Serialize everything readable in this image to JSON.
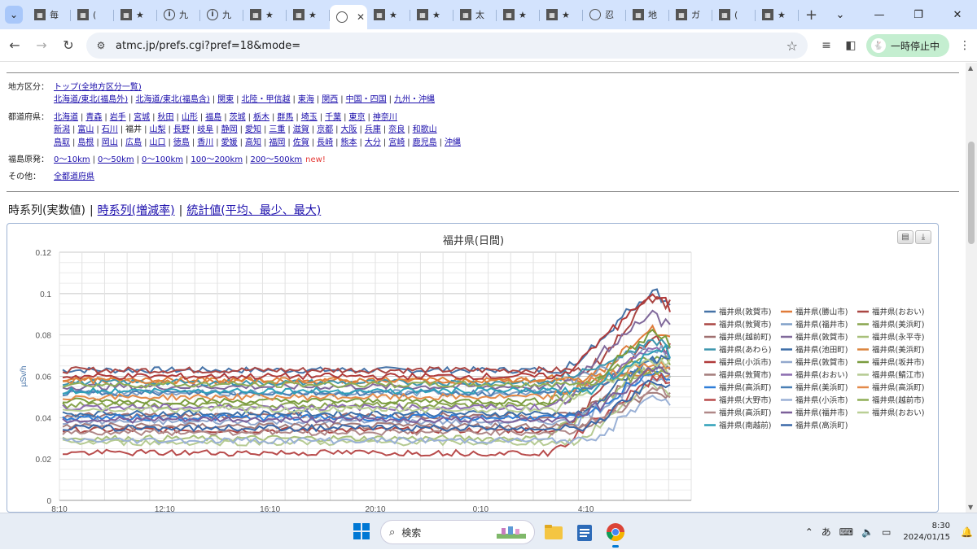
{
  "browser": {
    "tabs": [
      {
        "icon": "doc-icon",
        "label": "毎"
      },
      {
        "icon": "doc-icon",
        "label": "("
      },
      {
        "icon": "doc-icon",
        "label": "★"
      },
      {
        "icon": "info-icon",
        "label": "九"
      },
      {
        "icon": "info-icon",
        "label": "九"
      },
      {
        "icon": "doc-icon",
        "label": "★"
      },
      {
        "icon": "doc-icon",
        "label": "★"
      },
      {
        "icon": "globe-icon",
        "label": "",
        "active": true
      },
      {
        "icon": "doc-icon",
        "label": "★"
      },
      {
        "icon": "doc-icon",
        "label": "★"
      },
      {
        "icon": "doc-icon",
        "label": "太"
      },
      {
        "icon": "doc-icon",
        "label": "★"
      },
      {
        "icon": "doc-icon",
        "label": "★"
      },
      {
        "icon": "globe-icon",
        "label": "忍"
      },
      {
        "icon": "doc-icon",
        "label": "地"
      },
      {
        "icon": "doc-icon",
        "label": "ガ"
      },
      {
        "icon": "doc-icon",
        "label": "("
      },
      {
        "icon": "doc-icon",
        "label": "★"
      }
    ],
    "url": "atmc.jp/prefs.cgi?pref=18&mode=",
    "pause_label": "一時停止中"
  },
  "nav": {
    "region": {
      "label": "地方区分：",
      "lines": [
        [
          "トップ(全地方区分一覧)"
        ],
        [
          "北海道/東北(福島外)",
          "北海道/東北(福島含)",
          "関東",
          "北陸・甲信越",
          "東海",
          "関西",
          "中国・四国",
          "九州・沖縄"
        ]
      ]
    },
    "prefs": {
      "label": "都道府県：",
      "lines": [
        [
          "北海道",
          "青森",
          "岩手",
          "宮城",
          "秋田",
          "山形",
          "福島",
          "茨城",
          "栃木",
          "群馬",
          "埼玉",
          "千葉",
          "東京",
          "神奈川"
        ],
        [
          "新潟",
          "富山",
          "石川",
          "*福井",
          "山梨",
          "長野",
          "岐阜",
          "静岡",
          "愛知",
          "三重",
          "滋賀",
          "京都",
          "大阪",
          "兵庫",
          "奈良",
          "和歌山"
        ],
        [
          "鳥取",
          "島根",
          "岡山",
          "広島",
          "山口",
          "徳島",
          "香川",
          "愛媛",
          "高知",
          "福岡",
          "佐賀",
          "長崎",
          "熊本",
          "大分",
          "宮崎",
          "鹿児島",
          "沖縄"
        ]
      ]
    },
    "fukushima": {
      "label": "福島原発：",
      "links": [
        "0〜10km",
        "0〜50km",
        "0〜100km",
        "100〜200km",
        "200〜500km"
      ],
      "new_label": "new!"
    },
    "other": {
      "label": "その他：",
      "links": [
        "全都道府県"
      ]
    }
  },
  "modes": {
    "current": "時系列(実数値)",
    "links": [
      "時系列(増減率)",
      "統計値(平均、最少、最大)"
    ]
  },
  "chart_data": {
    "type": "line",
    "title": "福井県(日間)",
    "ylabel": "µSv/h",
    "xlabel": "",
    "ylim": [
      0,
      0.12
    ],
    "yticks": [
      "0",
      "0.02",
      "0.04",
      "0.06",
      "0.08",
      "0.1",
      "0.12"
    ],
    "xticks": [
      "8:10",
      "12:10",
      "16:10",
      "20:10",
      "0:10",
      "4:10"
    ],
    "grid": true,
    "legend_position": "right",
    "series": [
      {
        "name": "福井県(敦賀市)",
        "color": "#4572a7",
        "base": 0.063,
        "peak": 0.102
      },
      {
        "name": "福井県(勝山市)",
        "color": "#e07b39",
        "base": 0.058,
        "peak": 0.084
      },
      {
        "name": "福井県(おおい)",
        "color": "#aa4643",
        "base": 0.063,
        "peak": 0.099
      },
      {
        "name": "福井県(敦賀市)",
        "color": "#aa4643",
        "base": 0.034,
        "peak": 0.078
      },
      {
        "name": "福井県(福井市)",
        "color": "#80a0c8",
        "base": 0.052,
        "peak": 0.074
      },
      {
        "name": "福井県(美浜町)",
        "color": "#89a54e",
        "base": 0.046,
        "peak": 0.07
      },
      {
        "name": "福井県(越前町)",
        "color": "#a07070",
        "base": 0.041,
        "peak": 0.066
      },
      {
        "name": "福井県(敦賀市)",
        "color": "#80699b",
        "base": 0.055,
        "peak": 0.091
      },
      {
        "name": "福井県(永平寺)",
        "color": "#a8c07a",
        "base": 0.03,
        "peak": 0.064
      },
      {
        "name": "福井県(あわら)",
        "color": "#3d96ae",
        "base": 0.057,
        "peak": 0.076
      },
      {
        "name": "福井県(池田町)",
        "color": "#3d6ea8",
        "base": 0.042,
        "peak": 0.069
      },
      {
        "name": "福井県(美浜町)",
        "color": "#db843d",
        "base": 0.058,
        "peak": 0.061
      },
      {
        "name": "福井県(小浜市)",
        "color": "#b03a3a",
        "base": 0.06,
        "peak": 0.1
      },
      {
        "name": "福井県(敦賀市)",
        "color": "#92a8cd",
        "base": 0.038,
        "peak": 0.06
      },
      {
        "name": "福井県(坂井市)",
        "color": "#7a9c3e",
        "base": 0.048,
        "peak": 0.081
      },
      {
        "name": "福井県(敦賀市)",
        "color": "#a47d7c",
        "base": 0.036,
        "peak": 0.052
      },
      {
        "name": "福井県(おおい)",
        "color": "#8c6db0",
        "base": 0.045,
        "peak": 0.073
      },
      {
        "name": "福井県(鯖江市)",
        "color": "#b5ca92",
        "base": 0.028,
        "peak": 0.058
      },
      {
        "name": "福井県(高浜町)",
        "color": "#2f7ed8",
        "base": 0.04,
        "peak": 0.062
      },
      {
        "name": "福井県(美浜町)",
        "color": "#4a7fb5",
        "base": 0.052,
        "peak": 0.066
      },
      {
        "name": "福井県(高浜町)",
        "color": "#e38a4a",
        "base": 0.05,
        "peak": 0.067
      },
      {
        "name": "福井県(大野市)",
        "color": "#b84b4b",
        "base": 0.023,
        "peak": 0.059
      },
      {
        "name": "福井県(小浜市)",
        "color": "#9ab1d6",
        "base": 0.029,
        "peak": 0.05
      },
      {
        "name": "福井県(越前市)",
        "color": "#8fad55",
        "base": 0.056,
        "peak": 0.062
      },
      {
        "name": "福井県(高浜町)",
        "color": "#b08888",
        "base": 0.033,
        "peak": 0.054
      },
      {
        "name": "福井県(福井市)",
        "color": "#7c5f99",
        "base": 0.039,
        "peak": 0.063
      },
      {
        "name": "福井県(おおい)",
        "color": "#b9cf95",
        "base": 0.044,
        "peak": 0.068
      },
      {
        "name": "福井県(南越前)",
        "color": "#2ea0b8",
        "base": 0.053,
        "peak": 0.073
      },
      {
        "name": "福井県(高浜町)",
        "color": "#3a68a8",
        "base": 0.035,
        "peak": 0.058
      }
    ]
  },
  "taskbar": {
    "search_label": "検索",
    "ime": "あ",
    "time": "8:30",
    "date": "2024/01/15"
  }
}
